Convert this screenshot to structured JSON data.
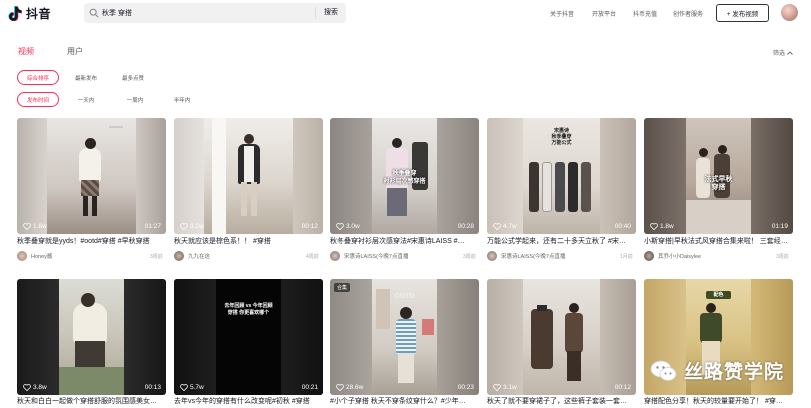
{
  "app": {
    "name": "抖音"
  },
  "search": {
    "query": "秋季 穿搭",
    "button": "搜索"
  },
  "nav": {
    "items": [
      "关于抖音",
      "开放平台",
      "抖币充值",
      "创作者服务"
    ],
    "publish": "+ 发布视频"
  },
  "tabs": [
    "视频",
    "用户"
  ],
  "filter": "筛选",
  "sort_chips": [
    "综合排序",
    "最新发布",
    "最多点赞"
  ],
  "time_chips": [
    "发布时间",
    "一天内",
    "一周内",
    "半年内"
  ],
  "colors": {
    "accent": "#fe2c55"
  },
  "videos": [
    {
      "likes": "1.8w",
      "duration": "01:27",
      "title": "秋季叠穿就是yyds！#ootd#穿搭 #早秋穿搭",
      "author": "Honey酱",
      "ago": "3周前"
    },
    {
      "likes": "3.2w",
      "duration": "00:12",
      "title": "秋天就应该是棕色系！！ #穿搭",
      "author": "九九在这",
      "ago": "4周前"
    },
    {
      "likes": "3.0w",
      "duration": "00:28",
      "title": "秋冬叠穿衬衫层次感穿法#宋惠诗LAISS #…",
      "author": "宋惠诗LAISS(今晚7点直播",
      "ago": "3周前",
      "overlay": "秋季叠穿\n衬衫层次感穿搭"
    },
    {
      "likes": "4.7w",
      "duration": "00:40",
      "title": "万能公式学起来，还有二十多天立秋了 #宋…",
      "author": "宋惠诗LAISS(今晚7点直播",
      "ago": "1月前",
      "overlay": "宋惠诗\n秋季叠穿\n万能公式"
    },
    {
      "likes": "1.8w",
      "duration": "01:19",
      "title": "小斯穿搭|早秋法式风穿搭合集来啦！ 三套经…",
      "author": "其乔小小Daisylee",
      "ago": "3周前",
      "overlay": "法式早秋\n穿搭"
    },
    {
      "likes": "3.8w",
      "duration": "00:13",
      "title": "秋天和白白一起做个穿搭舒服的氛围感美女…",
      "author": "",
      "ago": ""
    },
    {
      "likes": "5.7w",
      "duration": "00:21",
      "title": "去年vs今年的穿搭有什么改变呢#初秋 #穿搭",
      "author": "",
      "ago": "",
      "overlay": "去年回顾 vs 今年回顾\n穿搭 你更喜欢哪个"
    },
    {
      "likes": "28.6w",
      "duration": "00:23",
      "title": "#小个子穿搭 秋天不穿条纹穿什么？#少年…",
      "author": "",
      "ago": "",
      "badge": "合集",
      "overlay": "OOTD"
    },
    {
      "likes": "3.1w",
      "duration": "00:12",
      "title": "秋天了就不要穿裙子了，这些裤子套装一套…",
      "author": "",
      "ago": ""
    },
    {
      "likes": "",
      "duration": "",
      "title": "穿搭配色分享！秋天的较量要开始了！ #穿…",
      "author": "",
      "ago": "",
      "overlay": "配色"
    }
  ],
  "watermark": "丝路赞学院"
}
